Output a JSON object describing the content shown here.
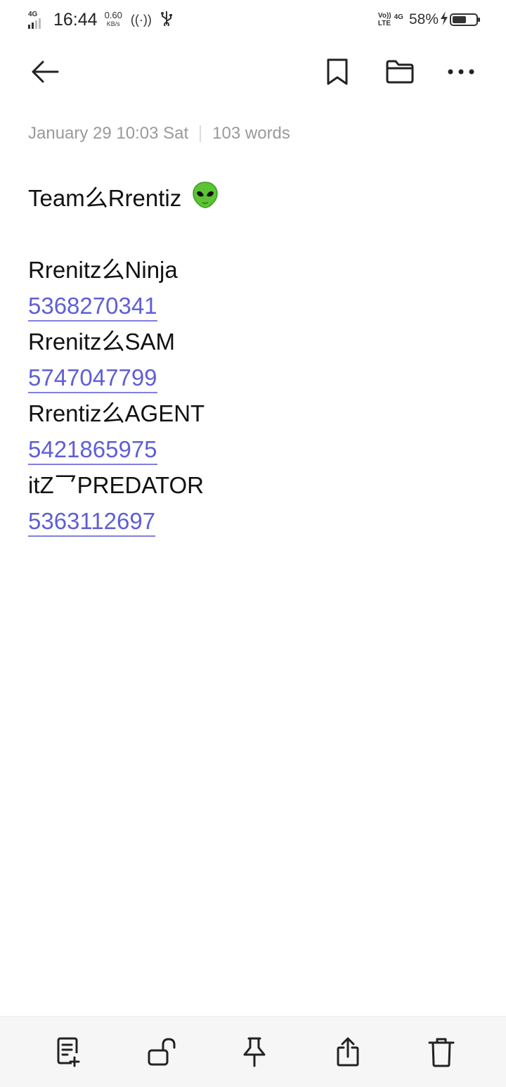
{
  "status_bar": {
    "network_left": "4G",
    "time": "16:44",
    "speed_value": "0.60",
    "speed_unit": "KB/s",
    "volte_top": "Vo))",
    "volte_bottom": "LTE",
    "network_right": "4G",
    "battery_percent": "58%",
    "battery_level": 0.58,
    "icons": [
      "hotspot-icon",
      "usb-icon",
      "charging-bolt-icon",
      "battery-icon"
    ]
  },
  "toolbar": {
    "back": "back-arrow-icon",
    "bookmark": "bookmark-icon",
    "folder": "folder-icon",
    "more": "more-dots-icon"
  },
  "meta": {
    "date": "January 29 10:03 Sat",
    "word_count": "103 words"
  },
  "note": {
    "title": "Team么Rrentiz",
    "title_emoji": "alien-emoji",
    "entries": [
      {
        "name": "Rrenitz么Ninja",
        "phone": "5368270341"
      },
      {
        "name": "Rrenitz么SAM",
        "phone": "5747047799"
      },
      {
        "name": "Rrentiz么AGENT",
        "phone": "5421865975"
      },
      {
        "name": "itZ乛PREDATOR",
        "phone": "5363112697"
      }
    ],
    "link_color": "#5f5fd6"
  },
  "bottom_bar": {
    "items": [
      "add-note-icon",
      "unlock-icon",
      "pin-icon",
      "share-icon",
      "delete-icon"
    ]
  }
}
